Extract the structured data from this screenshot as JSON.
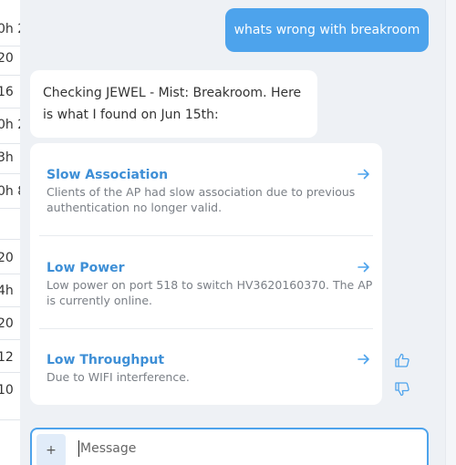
{
  "background_table": {
    "rows": [
      "0h 2",
      "20",
      "16",
      "0h 2",
      "3h",
      "0h 8",
      "",
      "20",
      "4h",
      "20",
      "12",
      "10"
    ]
  },
  "chat": {
    "user_message": "whats wrong with breakroom",
    "bot_message": "Checking JEWEL - Mist: Breakroom. Here is what I found on Jun 15th:",
    "findings": [
      {
        "title": "Slow Association",
        "description": "Clients of the AP had slow association due to previous authentication no longer valid."
      },
      {
        "title": "Low Power",
        "description": "Low power on port 518 to switch HV3620160370. The AP is currently online."
      },
      {
        "title": "Low Throughput",
        "description": "Due to WIFI interference."
      }
    ],
    "input": {
      "plus_label": "+",
      "placeholder": "Message",
      "value": ""
    }
  },
  "colors": {
    "accent": "#4da3ec",
    "link": "#3e8fd6",
    "muted": "#7a7f86",
    "panel_bg": "#eef1f5"
  }
}
